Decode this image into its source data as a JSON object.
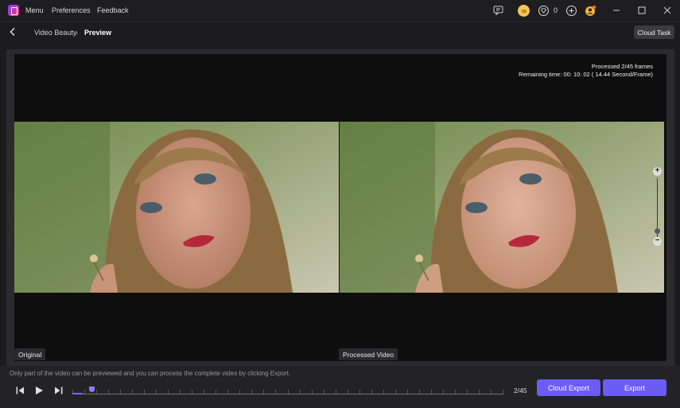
{
  "titlebar": {
    "menu_items": [
      "Menu",
      "Preferences",
      "Feedback"
    ],
    "gem_count": "0"
  },
  "nav": {
    "breadcrumb_parent": "Video Beauty",
    "breadcrumb_separator": "›",
    "breadcrumb_current": "Preview",
    "cloud_task_label": "Cloud Task"
  },
  "preview": {
    "processed_frames": "Processed 2/45 frames",
    "remaining_time": "Remaining time: 00: 10: 02 ( 14.44 Second/Frame)",
    "left_label": "Original",
    "right_label": "Processed Video"
  },
  "bottom": {
    "hint": "Only part of the video can be previewed and you can process the complete video by clicking Export.",
    "frame_position": "2/45",
    "progress_fraction": 0.024,
    "cloud_export_label": "Cloud Export",
    "export_label": "Export"
  },
  "colors": {
    "accent": "#6b5cf6",
    "background": "#1c1c1e",
    "stage": "#0e0e0f"
  },
  "icons": [
    "app-logo-icon",
    "chat-icon",
    "coin-icon",
    "gem-icon",
    "plus-circle-icon",
    "user-badge-icon",
    "minimize-icon",
    "maximize-icon",
    "close-icon",
    "back-arrow-icon",
    "zoom-in-icon",
    "zoom-out-icon",
    "previous-frame-icon",
    "play-icon",
    "next-frame-icon"
  ]
}
